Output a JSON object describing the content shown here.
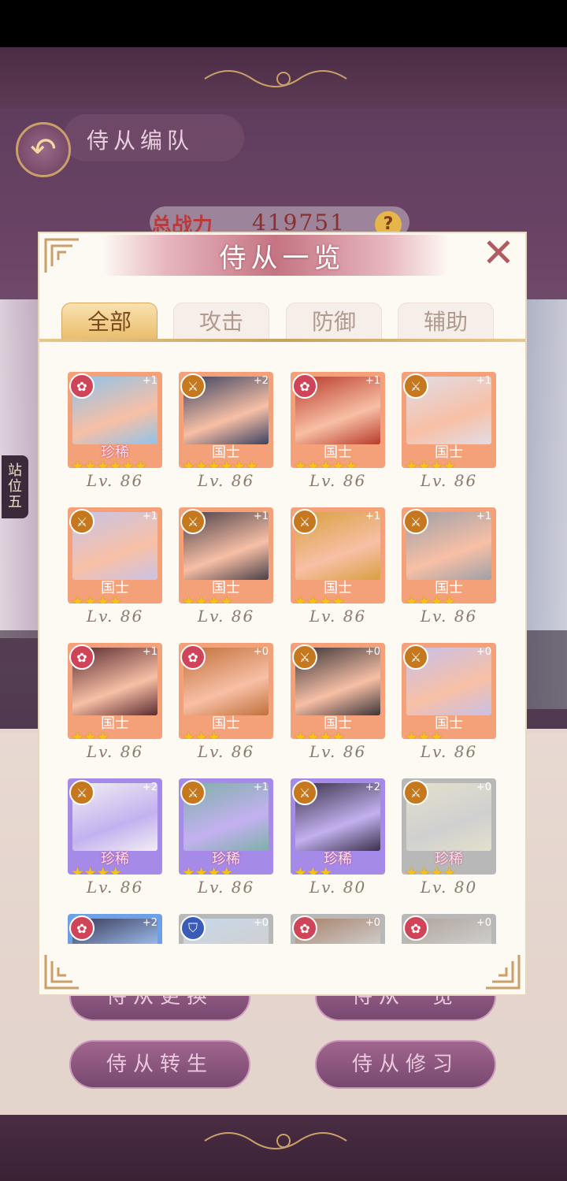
{
  "page": {
    "title": "侍从编队",
    "power_label": "总战力",
    "power_value": "419751",
    "help": "?",
    "side_tag": "站位五",
    "buttons": [
      "侍从更换",
      "侍从一览",
      "侍从转生",
      "侍从修习"
    ]
  },
  "modal": {
    "title": "侍从一览",
    "close": "✕",
    "tabs": [
      {
        "label": "全部",
        "active": true
      },
      {
        "label": "攻击",
        "active": false
      },
      {
        "label": "防御",
        "active": false
      },
      {
        "label": "辅助",
        "active": false
      }
    ],
    "cards": [
      {
        "rank": "珍稀",
        "plus": "+1",
        "level": "Lv. 86",
        "stars": 6,
        "frame": "orange",
        "badge": "flower",
        "portrait": "#8fc3ea"
      },
      {
        "rank": "国士",
        "plus": "+2",
        "level": "Lv. 86",
        "stars": 6,
        "frame": "orange",
        "badge": "sword",
        "portrait": "#3a4260"
      },
      {
        "rank": "国士",
        "plus": "+1",
        "level": "Lv. 86",
        "stars": 5,
        "frame": "orange",
        "badge": "flower",
        "portrait": "#b83a2a"
      },
      {
        "rank": "国士",
        "plus": "+1",
        "level": "Lv. 86",
        "stars": 4,
        "frame": "orange",
        "badge": "sword",
        "portrait": "#e0dde6"
      },
      {
        "rank": "国士",
        "plus": "+1",
        "level": "Lv. 86",
        "stars": 4,
        "frame": "orange",
        "badge": "sword",
        "portrait": "#c9c4e6"
      },
      {
        "rank": "国士",
        "plus": "+1",
        "level": "Lv. 86",
        "stars": 4,
        "frame": "orange",
        "badge": "sword",
        "portrait": "#4a4048"
      },
      {
        "rank": "国士",
        "plus": "+1",
        "level": "Lv. 86",
        "stars": 4,
        "frame": "orange",
        "badge": "sword",
        "portrait": "#d8a040"
      },
      {
        "rank": "国士",
        "plus": "+1",
        "level": "Lv. 86",
        "stars": 4,
        "frame": "orange",
        "badge": "sword",
        "portrait": "#9ea0a8"
      },
      {
        "rank": "国士",
        "plus": "+1",
        "level": "Lv. 86",
        "stars": 3,
        "frame": "orange",
        "badge": "flower",
        "portrait": "#5a2a30"
      },
      {
        "rank": "国士",
        "plus": "+0",
        "level": "Lv. 86",
        "stars": 3,
        "frame": "orange",
        "badge": "flower",
        "portrait": "#c0703a"
      },
      {
        "rank": "国士",
        "plus": "+0",
        "level": "Lv. 86",
        "stars": 4,
        "frame": "orange",
        "badge": "sword",
        "portrait": "#3a3438"
      },
      {
        "rank": "国士",
        "plus": "+0",
        "level": "Lv. 86",
        "stars": 3,
        "frame": "orange",
        "badge": "sword",
        "portrait": "#c8c0e8"
      },
      {
        "rank": "珍稀",
        "plus": "+2",
        "level": "Lv. 86",
        "stars": 4,
        "frame": "purple",
        "badge": "sword",
        "portrait": "#f2eef2"
      },
      {
        "rank": "珍稀",
        "plus": "+1",
        "level": "Lv. 86",
        "stars": 4,
        "frame": "purple",
        "badge": "sword",
        "portrait": "#7fb0a8"
      },
      {
        "rank": "珍稀",
        "plus": "+2",
        "level": "Lv. 80",
        "stars": 3,
        "frame": "purple",
        "badge": "sword",
        "portrait": "#3a3048"
      },
      {
        "rank": "珍稀",
        "plus": "+0",
        "level": "Lv. 80",
        "stars": 4,
        "frame": "gray",
        "badge": "sword",
        "portrait": "#e4e0cc"
      },
      {
        "rank": "",
        "plus": "+2",
        "level": "",
        "stars": 0,
        "frame": "blue",
        "badge": "flower",
        "portrait": "#3a3a58"
      },
      {
        "rank": "",
        "plus": "+0",
        "level": "",
        "stars": 0,
        "frame": "gray",
        "badge": "shield",
        "portrait": "#c8d8ec"
      },
      {
        "rank": "",
        "plus": "+0",
        "level": "",
        "stars": 0,
        "frame": "gray",
        "badge": "flower",
        "portrait": "#a88068"
      },
      {
        "rank": "",
        "plus": "+0",
        "level": "",
        "stars": 0,
        "frame": "gray",
        "badge": "flower",
        "portrait": "#b0a49a"
      }
    ]
  },
  "colors": {
    "modal_bg": "#fdf9f3",
    "tab_active": "#e9bd6c",
    "star": "#f5c21b",
    "header_pink": "#c57482"
  }
}
